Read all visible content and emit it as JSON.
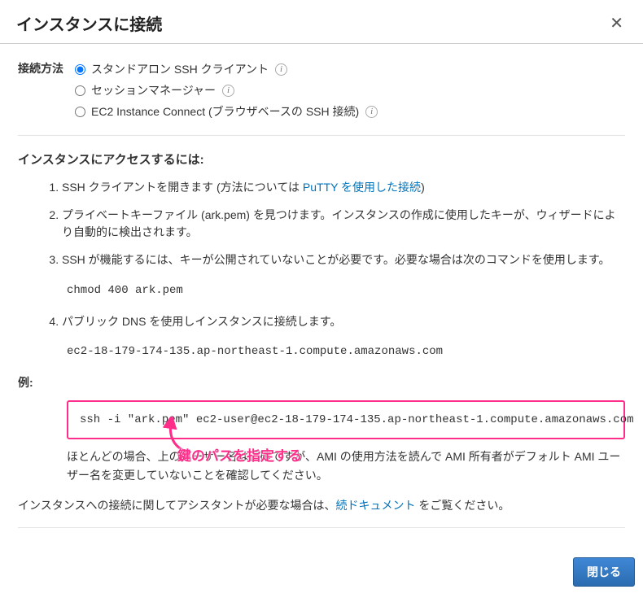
{
  "title": "インスタンスに接続",
  "close_glyph": "✕",
  "method": {
    "label": "接続方法",
    "options": [
      {
        "label": "スタンドアロン SSH クライアント",
        "checked": true
      },
      {
        "label": "セッションマネージャー",
        "checked": false
      },
      {
        "label": "EC2 Instance Connect (ブラウザベースの SSH 接続)",
        "checked": false
      }
    ]
  },
  "access_heading": "インスタンスにアクセスするには:",
  "steps": {
    "s1a": "SSH クライアントを開きます (方法については ",
    "s1_link": "PuTTY を使用した接続",
    "s1b": ")",
    "s2": "プライベートキーファイル (ark.pem) を見つけます。インスタンスの作成に使用したキーが、ウィザードにより自動的に検出されます。",
    "s3": "SSH が機能するには、キーが公開されていないことが必要です。必要な場合は次のコマンドを使用します。",
    "chmod_cmd": "chmod 400 ark.pem",
    "s4": "パブリック DNS を使用しインスタンスに接続します。",
    "dns_cmd": "ec2-18-179-174-135.ap-northeast-1.compute.amazonaws.com"
  },
  "example_label": "例:",
  "example_cmd": "ssh -i \"ark.pem\" ec2-user@ec2-18-179-174-135.ap-northeast-1.compute.amazonaws.com",
  "ami_note": "ほとんどの場合、上のユーザー名は正確ですが、AMI の使用方法を読んで AMI 所有者がデフォルト AMI ユーザー名を変更していないことを確認してください。",
  "footer_a": "インスタンスへの接続に関してアシスタントが必要な場合は、",
  "footer_link": "続ドキュメント",
  "footer_b": " をご覧ください。",
  "btn_close": "閉じる",
  "annotation": "鍵のパスを指定する"
}
